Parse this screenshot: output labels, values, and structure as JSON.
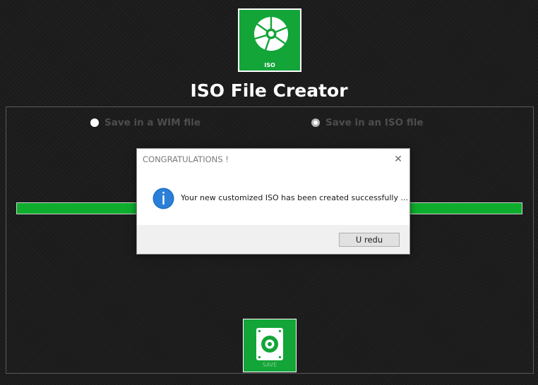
{
  "app": {
    "title": "ISO File Creator",
    "logo_label": "ISO",
    "logo_icon": "disc-icon",
    "accent_color": "#13a538"
  },
  "options": [
    {
      "label": "Save in a WIM file",
      "selected": false
    },
    {
      "label": "Save in an ISO file",
      "selected": true
    }
  ],
  "progress": {
    "value_percent": 100,
    "color": "#0fad2e"
  },
  "save_button": {
    "label": "SAVE",
    "icon": "hard-drive-icon"
  },
  "dialog": {
    "title": "CONGRATULATIONS !",
    "message": "Your new customized ISO has been created successfully ...",
    "icon": "info-icon",
    "close_icon": "close-icon",
    "ok_label": "U redu"
  }
}
